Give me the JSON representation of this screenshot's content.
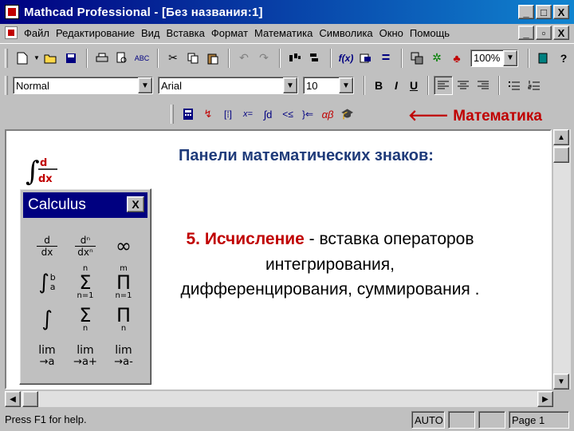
{
  "window": {
    "title": "Mathcad Professional - [Без названия:1]",
    "buttons": [
      "_",
      "□",
      "X"
    ]
  },
  "menu": {
    "items": [
      "Файл",
      "Редактирование",
      "Вид",
      "Вставка",
      "Формат",
      "Математика",
      "Символика",
      "Окно",
      "Помощь"
    ],
    "doc_buttons": [
      "_",
      "▫",
      "X"
    ]
  },
  "toolbar": {
    "zoom": "100%"
  },
  "format_bar": {
    "style": "Normal",
    "font": "Arial",
    "size": "10",
    "bold": "B",
    "italic": "I",
    "underline": "U"
  },
  "math_bar": {
    "label": "Математика"
  },
  "document": {
    "heading": "Панели математических знаков:",
    "desc_keyword": "5. Исчисление",
    "desc_rest": " - вставка операторов интегрирования, дифференцирования, суммирования ."
  },
  "palette": {
    "title": "Calculus",
    "close": "X",
    "derivative": {
      "num": "d",
      "den": "dx"
    },
    "nth_derivative": {
      "num": "dⁿ",
      "den": "dxⁿ"
    },
    "infinity": "∞",
    "definite_integral": {
      "sym": "∫",
      "upper": "b",
      "lower": "a"
    },
    "range_sum": {
      "top": "n",
      "sym": "Σ",
      "bottom": "n=1"
    },
    "range_product": {
      "top": "m",
      "sym": "Π",
      "bottom": "n=1"
    },
    "indefinite_integral": "∫",
    "sum": {
      "sym": "Σ",
      "bottom": "n"
    },
    "product": {
      "sym": "Π",
      "bottom": "n"
    },
    "limits": [
      {
        "label": "lim",
        "sub": "→a"
      },
      {
        "label": "lim",
        "sub": "→a+"
      },
      {
        "label": "lim",
        "sub": "→a-"
      }
    ]
  },
  "statusbar": {
    "help": "Press F1 for help.",
    "mode": "AUTO",
    "page": "Page 1"
  },
  "colors": {
    "title_bar": "#000080",
    "accent_red": "#c00000",
    "heading_blue": "#1f3b7a"
  }
}
